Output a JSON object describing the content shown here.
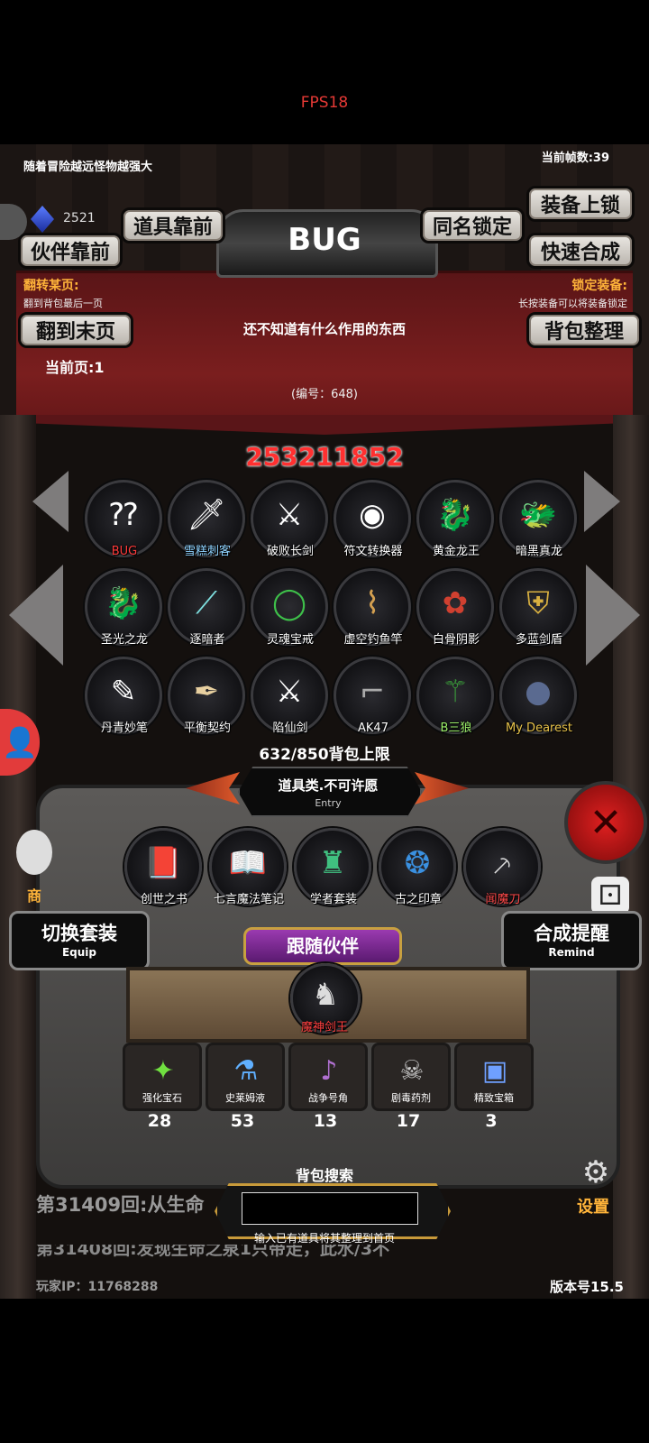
{
  "fps": "FPS18",
  "header": {
    "hint": "随着冒险越远怪物越强大",
    "frames": "当前帧数:39",
    "currency": "2521",
    "version": "版本号15.5",
    "player_ip": "玩家IP：11768288"
  },
  "buttons": {
    "item_front": "道具靠前",
    "partner_front": "伙伴靠前",
    "same_name_lock": "同名锁定",
    "equip_lock": "装备上锁",
    "quick_combine": "快速合成",
    "last_page": "翻到末页",
    "sort_bag": "背包整理",
    "switch_suit": "切换套装",
    "switch_suit_sub": "Equip",
    "combine_remind": "合成提醒",
    "combine_remind_sub": "Remind",
    "follow_partner": "跟随伙伴",
    "settings": "设置",
    "shop": "商"
  },
  "banner": {
    "title": "BUG",
    "left_title": "翻转某页:",
    "left_sub": "翻到背包最后一页",
    "right_title": "锁定装备:",
    "right_sub": "长按装备可以将装备锁定",
    "description": "还不知道有什么作用的东西",
    "number": "(编号：648)",
    "current_page": "当前页:1"
  },
  "score": "253211852",
  "items": [
    {
      "name": "BUG",
      "icon": "bug",
      "color": "#c8202a"
    },
    {
      "name": "雪糕刺客",
      "icon": "dagger",
      "color": "#8fd3ff"
    },
    {
      "name": "破败长剑",
      "icon": "sword",
      "color": "#ffffff"
    },
    {
      "name": "符文转换器",
      "icon": "rune",
      "color": "#ffffff"
    },
    {
      "name": "黄金龙王",
      "icon": "dragon",
      "color": "#ffffff"
    },
    {
      "name": "暗黑真龙",
      "icon": "dragon-dark",
      "color": "#ffffff"
    },
    {
      "name": "圣光之龙",
      "icon": "dragon-gold",
      "color": "#ffffff"
    },
    {
      "name": "逐暗者",
      "icon": "spear",
      "color": "#ffffff"
    },
    {
      "name": "灵魂宝戒",
      "icon": "ring",
      "color": "#ffffff"
    },
    {
      "name": "虚空钓鱼竿",
      "icon": "rod",
      "color": "#ffffff"
    },
    {
      "name": "白骨阴影",
      "icon": "bone",
      "color": "#ffffff"
    },
    {
      "name": "多蓝剑盾",
      "icon": "shield",
      "color": "#ffffff"
    },
    {
      "name": "丹青妙笔",
      "icon": "brush",
      "color": "#ffffff"
    },
    {
      "name": "平衡契约",
      "icon": "contract",
      "color": "#ffffff"
    },
    {
      "name": "陷仙剑",
      "icon": "sword",
      "color": "#ffffff"
    },
    {
      "name": "AK47",
      "icon": "gun",
      "color": "#ffffff"
    },
    {
      "name": "B三狼",
      "icon": "wolf",
      "color": "#9cf06a"
    },
    {
      "name": "My Dearest",
      "icon": "orb",
      "color": "#e8c34a"
    }
  ],
  "bag_limit": "632/850背包上限",
  "entry": {
    "label": "道具类.不可许愿",
    "sub": "Entry"
  },
  "special": [
    {
      "name": "创世之书",
      "icon": "book",
      "color": "#ffffff"
    },
    {
      "name": "七言魔法笔记",
      "icon": "open-book",
      "color": "#ffffff"
    },
    {
      "name": "学者套装",
      "icon": "scholar",
      "color": "#ffffff"
    },
    {
      "name": "古之印章",
      "icon": "amulet",
      "color": "#ffffff"
    },
    {
      "name": "闻魔刀",
      "icon": "blade",
      "color": "#ff4a4a"
    }
  ],
  "partner": {
    "name": "魔神剑王"
  },
  "materials": [
    {
      "name": "强化宝石",
      "icon": "gem",
      "count": "28"
    },
    {
      "name": "史莱姆液",
      "icon": "potion",
      "count": "53"
    },
    {
      "name": "战争号角",
      "icon": "horn",
      "count": "13"
    },
    {
      "name": "剧毒药剂",
      "icon": "poison",
      "count": "17"
    },
    {
      "name": "精致宝箱",
      "icon": "chest",
      "count": "3"
    }
  ],
  "search": {
    "title": "背包搜索",
    "hint": "输入已有道具将其整理到首页",
    "value": ""
  },
  "log": {
    "line1": "第31409回:从生命",
    "line2": "第31408回:发现生命之泉1只带走，此水/3不"
  },
  "colors": {
    "banner": "#7a1e1e",
    "score": "#ff3030",
    "purple": "#7a2a8f"
  }
}
